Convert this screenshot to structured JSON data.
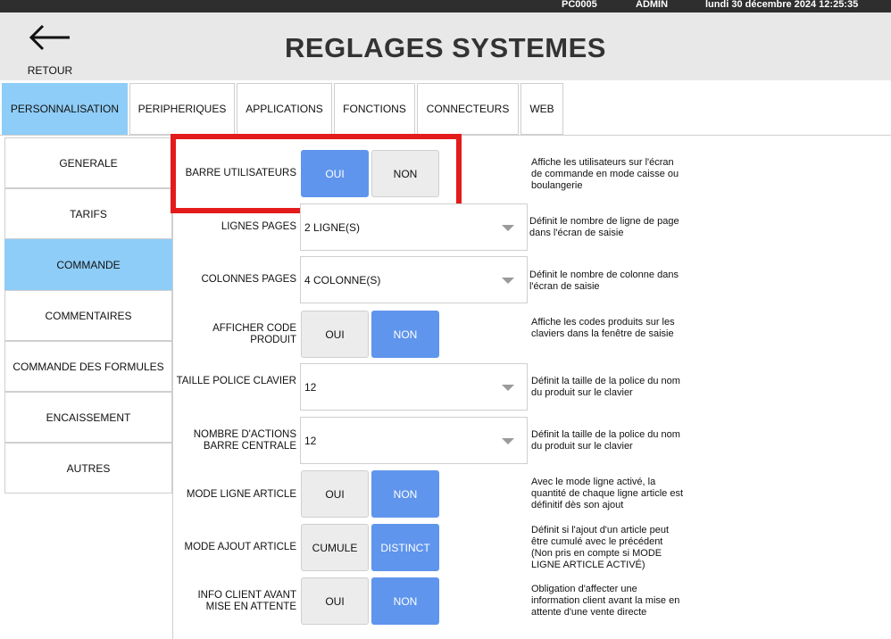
{
  "status_bar": {
    "terminal": "PC0005",
    "user": "ADMIN",
    "datetime": "lundi 30 décembre 2024 12:25:35"
  },
  "header": {
    "back_label": "RETOUR",
    "title": "REGLAGES SYSTEMES"
  },
  "tabs": [
    {
      "label": "PERSONNALISATION",
      "active": true
    },
    {
      "label": "PERIPHERIQUES"
    },
    {
      "label": "APPLICATIONS"
    },
    {
      "label": "FONCTIONS"
    },
    {
      "label": "CONNECTEURS"
    },
    {
      "label": "WEB"
    }
  ],
  "sidebar": {
    "items": [
      {
        "label": "GENERALE"
      },
      {
        "label": "TARIFS"
      },
      {
        "label": "COMMANDE",
        "active": true
      },
      {
        "label": "COMMENTAIRES"
      },
      {
        "label": "COMMANDE DES FORMULES"
      },
      {
        "label": "ENCAISSEMENT"
      },
      {
        "label": "AUTRES"
      }
    ]
  },
  "settings": [
    {
      "label": "BARRE UTILISATEURS",
      "type": "toggle",
      "options": [
        "OUI",
        "NON"
      ],
      "selected": "OUI",
      "description": "Affiche les utilisateurs sur l'écran de commande en mode caisse ou boulangerie"
    },
    {
      "label": "LIGNES PAGES",
      "type": "select",
      "value": "2 LIGNE(S)",
      "description": "Définit le nombre de ligne de page dans l'écran de saisie"
    },
    {
      "label": "COLONNES PAGES",
      "type": "select",
      "value": "4 COLONNE(S)",
      "description": "Définit le nombre de colonne dans l'écran de saisie"
    },
    {
      "label": "AFFICHER CODE PRODUIT",
      "type": "toggle",
      "options": [
        "OUI",
        "NON"
      ],
      "selected": "NON",
      "description": "Affiche les codes produits sur les claviers dans la fenêtre de saisie"
    },
    {
      "label": "TAILLE POLICE CLAVIER",
      "type": "select",
      "value": "12",
      "description": "Définit la taille de la police du nom du produit sur le clavier"
    },
    {
      "label": "NOMBRE D'ACTIONS BARRE CENTRALE",
      "type": "select",
      "value": "12",
      "description": "Définit la taille de la police du nom du produit sur le clavier"
    },
    {
      "label": "MODE LIGNE ARTICLE",
      "type": "toggle",
      "options": [
        "OUI",
        "NON"
      ],
      "selected": "NON",
      "description": "Avec le mode ligne activé, la quantité de chaque ligne article est définitif dès son ajout"
    },
    {
      "label": "MODE AJOUT ARTICLE",
      "type": "toggle",
      "options": [
        "CUMULE",
        "DISTINCT"
      ],
      "selected": "DISTINCT",
      "description": "Définit si l'ajout d'un article peut être cumulé avec le précédent (Non pris en compte si MODE LIGNE ARTICLE ACTIVÉ)"
    },
    {
      "label": "INFO CLIENT AVANT MISE EN ATTENTE",
      "type": "toggle",
      "options": [
        "OUI",
        "NON"
      ],
      "selected": "NON",
      "description": "Obligation d'affecter une information client avant la mise en attente d'une vente directe"
    }
  ],
  "colors": {
    "accent_blue": "#5f95ec",
    "active_tab": "#8ecdf7",
    "highlight_red": "#e31b1b"
  }
}
